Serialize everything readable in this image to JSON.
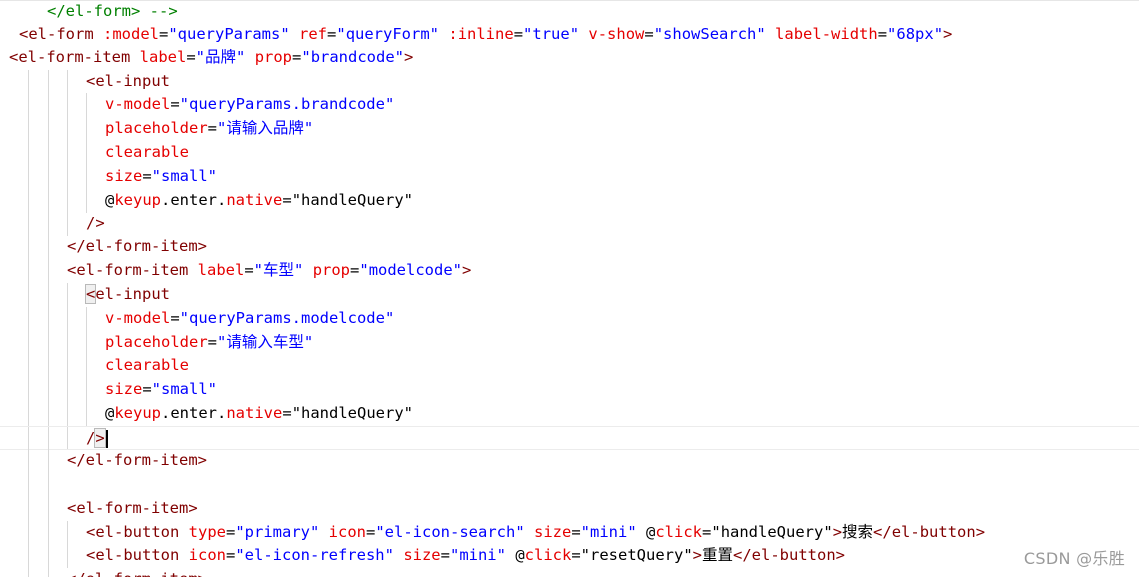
{
  "editor": {
    "lines": [
      [
        [
          "tk-comment",
          "</el-form> -->"
        ]
      ],
      [
        [
          "tk-tag",
          "<el-form "
        ],
        [
          "tk-attr",
          ":model"
        ],
        [
          "tk-text",
          "="
        ],
        [
          "tk-str",
          "\"queryParams\""
        ],
        [
          "tk-text",
          " "
        ],
        [
          "tk-attr",
          "ref"
        ],
        [
          "tk-text",
          "="
        ],
        [
          "tk-str",
          "\"queryForm\""
        ],
        [
          "tk-text",
          " "
        ],
        [
          "tk-attr",
          ":inline"
        ],
        [
          "tk-text",
          "="
        ],
        [
          "tk-str",
          "\"true\""
        ],
        [
          "tk-text",
          " "
        ],
        [
          "tk-attr",
          "v-show"
        ],
        [
          "tk-text",
          "="
        ],
        [
          "tk-str",
          "\"showSearch\""
        ],
        [
          "tk-text",
          " "
        ],
        [
          "tk-attr",
          "label-width"
        ],
        [
          "tk-text",
          "="
        ],
        [
          "tk-str",
          "\"68px\""
        ],
        [
          "tk-tag",
          ">"
        ]
      ],
      [
        [
          "tk-tag",
          "<el-form-item "
        ],
        [
          "tk-attr",
          "label"
        ],
        [
          "tk-text",
          "="
        ],
        [
          "tk-str",
          "\"品牌\""
        ],
        [
          "tk-text",
          " "
        ],
        [
          "tk-attr",
          "prop"
        ],
        [
          "tk-text",
          "="
        ],
        [
          "tk-str",
          "\"brandcode\""
        ],
        [
          "tk-tag",
          ">"
        ]
      ],
      [
        [
          "tk-tag",
          "<el-input"
        ]
      ],
      [
        [
          "tk-attr",
          "v-model"
        ],
        [
          "tk-text",
          "="
        ],
        [
          "tk-str",
          "\"queryParams.brandcode\""
        ]
      ],
      [
        [
          "tk-attr",
          "placeholder"
        ],
        [
          "tk-text",
          "="
        ],
        [
          "tk-str",
          "\"请输入品牌\""
        ]
      ],
      [
        [
          "tk-attr",
          "clearable"
        ]
      ],
      [
        [
          "tk-attr",
          "size"
        ],
        [
          "tk-text",
          "="
        ],
        [
          "tk-str",
          "\"small\""
        ]
      ],
      [
        [
          "tk-text",
          "@"
        ],
        [
          "tk-attr",
          "keyup"
        ],
        [
          "tk-text",
          ".enter."
        ],
        [
          "tk-attr",
          "native"
        ],
        [
          "tk-text",
          "="
        ],
        [
          "tk-text",
          "\"handleQuery\""
        ]
      ],
      [
        [
          "tk-tag",
          "/>"
        ]
      ],
      [
        [
          "tk-tag",
          "</el-form-item>"
        ]
      ],
      [
        [
          "tk-tag",
          "<el-form-item "
        ],
        [
          "tk-attr",
          "label"
        ],
        [
          "tk-text",
          "="
        ],
        [
          "tk-str",
          "\"车型\""
        ],
        [
          "tk-text",
          " "
        ],
        [
          "tk-attr",
          "prop"
        ],
        [
          "tk-text",
          "="
        ],
        [
          "tk-str",
          "\"modelcode\""
        ],
        [
          "tk-tag",
          ">"
        ]
      ],
      [
        [
          "tk-tag match",
          "<"
        ],
        [
          "tk-tag",
          "el-input"
        ]
      ],
      [
        [
          "tk-attr",
          "v-model"
        ],
        [
          "tk-text",
          "="
        ],
        [
          "tk-str",
          "\"queryParams.modelcode\""
        ]
      ],
      [
        [
          "tk-attr",
          "placeholder"
        ],
        [
          "tk-text",
          "="
        ],
        [
          "tk-str",
          "\"请输入车型\""
        ]
      ],
      [
        [
          "tk-attr",
          "clearable"
        ]
      ],
      [
        [
          "tk-attr",
          "size"
        ],
        [
          "tk-text",
          "="
        ],
        [
          "tk-str",
          "\"small\""
        ]
      ],
      [
        [
          "tk-text",
          "@"
        ],
        [
          "tk-attr",
          "keyup"
        ],
        [
          "tk-text",
          ".enter."
        ],
        [
          "tk-attr",
          "native"
        ],
        [
          "tk-text",
          "="
        ],
        [
          "tk-text",
          "\"handleQuery\""
        ]
      ],
      [
        [
          "tk-tag",
          "/"
        ],
        [
          "tk-tag match",
          ">"
        ]
      ],
      [
        [
          "tk-tag",
          "</el-form-item>"
        ]
      ],
      [],
      [
        [
          "tk-tag",
          "<el-form-item>"
        ]
      ],
      [
        [
          "tk-tag",
          "<el-button "
        ],
        [
          "tk-attr",
          "type"
        ],
        [
          "tk-text",
          "="
        ],
        [
          "tk-str",
          "\"primary\""
        ],
        [
          "tk-text",
          " "
        ],
        [
          "tk-attr",
          "icon"
        ],
        [
          "tk-text",
          "="
        ],
        [
          "tk-str",
          "\"el-icon-search\""
        ],
        [
          "tk-text",
          " "
        ],
        [
          "tk-attr",
          "size"
        ],
        [
          "tk-text",
          "="
        ],
        [
          "tk-str",
          "\"mini\""
        ],
        [
          "tk-text",
          " @"
        ],
        [
          "tk-attr",
          "click"
        ],
        [
          "tk-text",
          "="
        ],
        [
          "tk-text",
          "\"handleQuery\""
        ],
        [
          "tk-tag",
          ">"
        ],
        [
          "tk-text",
          "搜索"
        ],
        [
          "tk-tag",
          "</el-button>"
        ]
      ],
      [
        [
          "tk-tag",
          "<el-button "
        ],
        [
          "tk-attr",
          "icon"
        ],
        [
          "tk-text",
          "="
        ],
        [
          "tk-str",
          "\"el-icon-refresh\""
        ],
        [
          "tk-text",
          " "
        ],
        [
          "tk-attr",
          "size"
        ],
        [
          "tk-text",
          "="
        ],
        [
          "tk-str",
          "\"mini\""
        ],
        [
          "tk-text",
          " @"
        ],
        [
          "tk-attr",
          "click"
        ],
        [
          "tk-text",
          "="
        ],
        [
          "tk-text",
          "\"resetQuery\""
        ],
        [
          "tk-tag",
          ">"
        ],
        [
          "tk-text",
          "重置"
        ],
        [
          "tk-tag",
          "</el-button>"
        ]
      ],
      [
        [
          "tk-tag",
          "</el-form-item>"
        ]
      ]
    ]
  },
  "watermark": "CSDN @乐胜"
}
